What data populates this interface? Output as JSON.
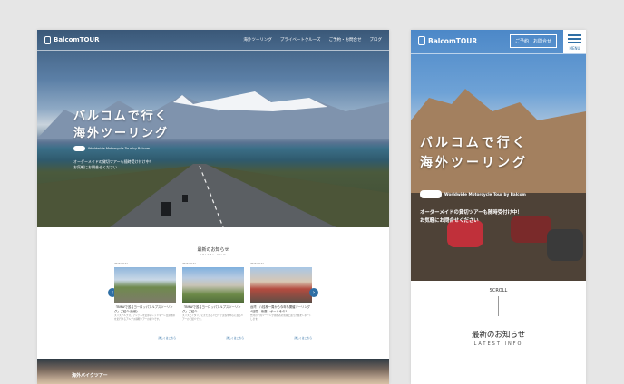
{
  "brand": {
    "logo_text": "BalcomTOUR"
  },
  "desktop": {
    "nav": [
      "海外ツーリング",
      "プライベートクルーズ",
      "ご予約・お問合せ",
      "ブログ"
    ],
    "tagline_line1": "バルコムで行く",
    "tagline_line2": "海外ツーリング",
    "motto": "Worldwide Motorcycle Tour by Balcom",
    "order_line1": "オーダーメイドの貸切ツアーも随時受け付け中！",
    "order_line2": "お気軽にお問合せください",
    "news": {
      "title": "最新のお知らせ",
      "subtitle": "LATEST INFO",
      "cards": [
        {
          "date": "2016.09.21",
          "title": "『BMWで巡るヨーロッパアルプスツーリング』ご紹介(後編)",
          "desc": "スイスアルプス、アンデルマ近郊にレッドマーレ温泉地帯を走行するアルプス横断ツアーの紹介です。",
          "more": "詳しくはこちら"
        },
        {
          "date": "2016.09.21",
          "title": "『BMWで巡るヨーロッパアルプスツーリング』ご紹介",
          "desc": "スイスとイタリアにまたがるドロミテ渓谷を中心に巡るツアーのご紹介です。",
          "more": "詳しくはこちら"
        },
        {
          "date": "2016.09.21",
          "title": "台湾　八桂林一周から今年も開催ツーリング4日間　後藤レポートその1",
          "desc": "台湾の一周ツーリング参加者の皆様と巡った旅をレポートします。",
          "more": "詳しくはこちら"
        }
      ]
    },
    "bottom_label": "海外バイクツアー"
  },
  "mobile": {
    "contact_button": "ご予約・お問合せ",
    "menu_label": "MENU",
    "tagline_line1": "バルコムで行く",
    "tagline_line2": "海外ツーリング",
    "motto": "Worldwide Motorcycle Tour by Balcom",
    "order_line1": "オーダーメイドの貸切ツアーも随時受付け中！",
    "order_line2": "お気軽にお問合せください",
    "scroll": "SCROLL",
    "news_title": "最新のお知らせ",
    "news_subtitle": "LATEST INFO"
  },
  "colors": {
    "accent": "#2f6fa5",
    "background": "#e6e6e6"
  },
  "icons": [
    "logo-mark-icon",
    "motorcycle-icon",
    "arrow-left-icon",
    "arrow-right-icon",
    "hamburger-menu-icon"
  ]
}
